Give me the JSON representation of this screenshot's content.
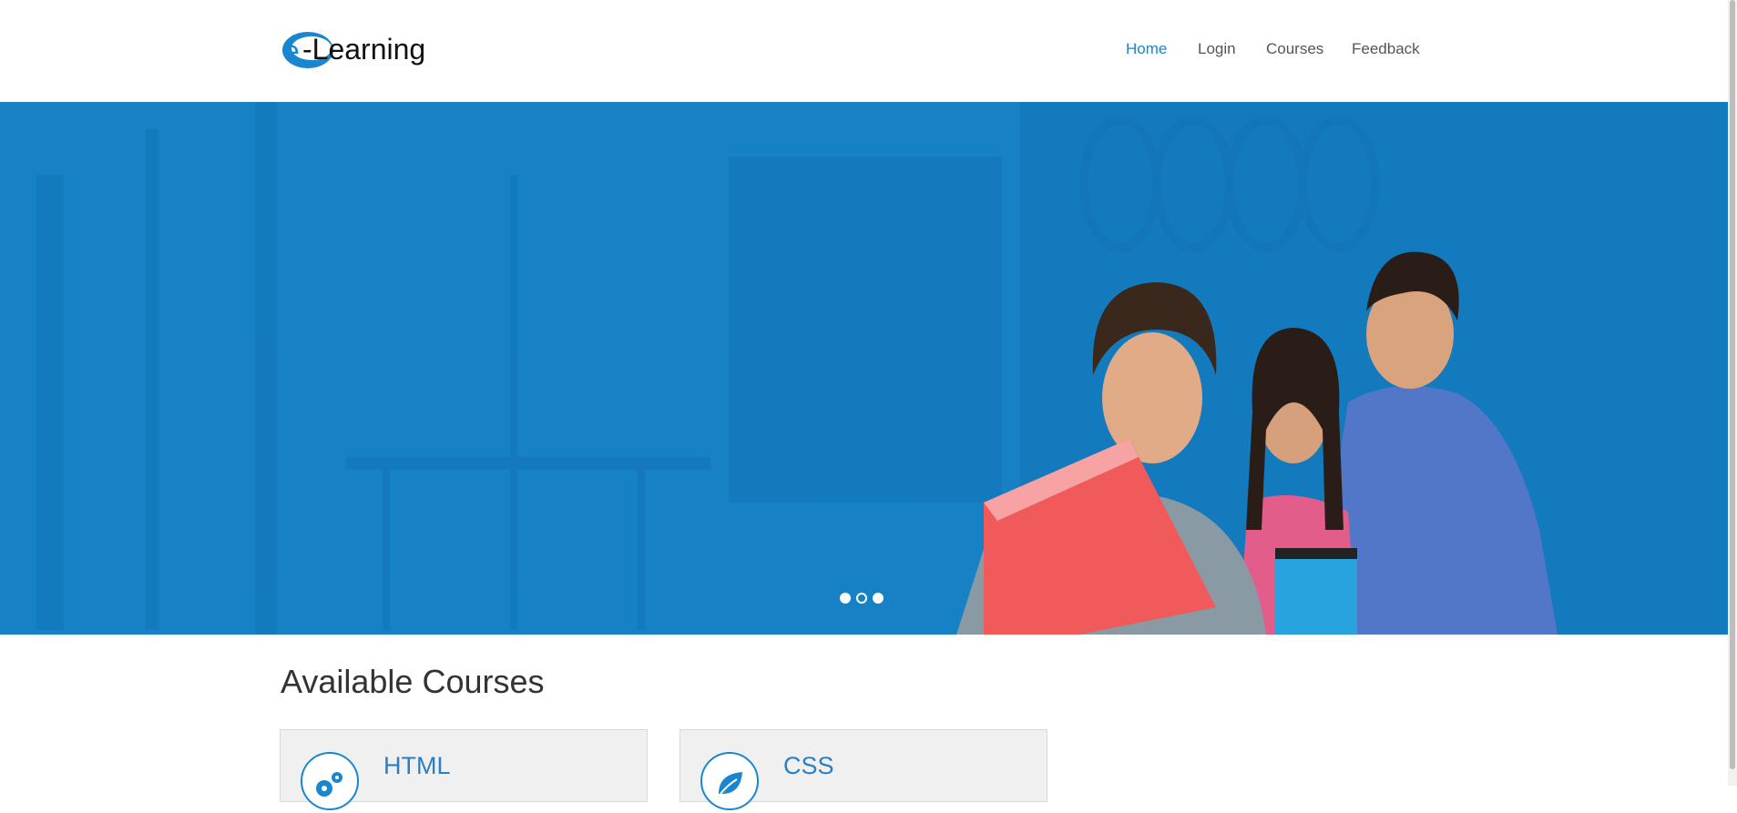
{
  "header": {
    "logo": {
      "prefix": "e",
      "text": "-Learning"
    },
    "nav": [
      {
        "label": "Home",
        "active": true
      },
      {
        "label": "Login",
        "active": false
      },
      {
        "label": "Courses",
        "active": false
      },
      {
        "label": "Feedback",
        "active": false
      }
    ]
  },
  "hero": {
    "slides": {
      "count": 3,
      "current": 2
    }
  },
  "courses": {
    "title": "Available Courses",
    "items": [
      {
        "name": "HTML",
        "icon": "gears-icon"
      },
      {
        "name": "CSS",
        "icon": "leaf-icon"
      }
    ]
  },
  "colors": {
    "accent": "#1a86d0",
    "hero_bg": "#1781c6",
    "card_bg": "#f0f0f0"
  }
}
